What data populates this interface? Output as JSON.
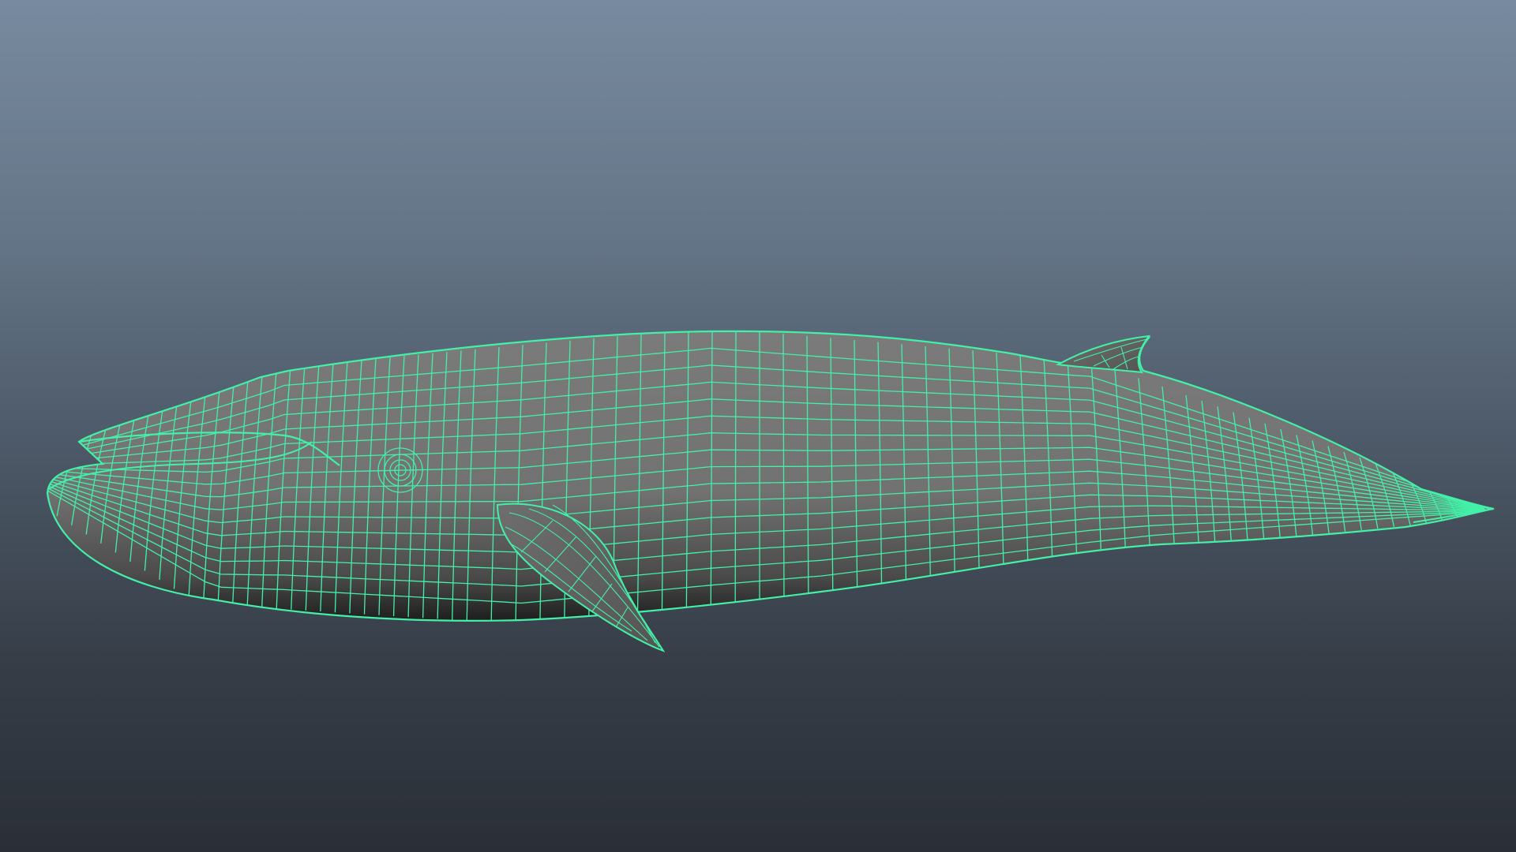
{
  "viewport": {
    "background_top": "#788a9f",
    "background_bottom": "#2a2f37",
    "wireframe_color": "#43f0a8",
    "surface_color": "#7a7a7a"
  },
  "model": {
    "name_icon": "whale-wireframe-model",
    "display_mode": "wireframe-on-shaded"
  }
}
